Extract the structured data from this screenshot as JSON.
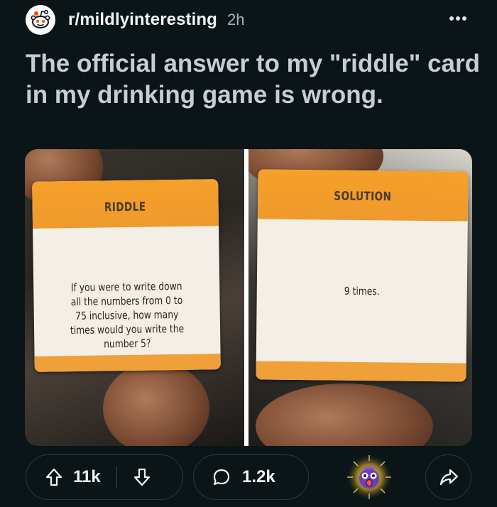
{
  "post": {
    "subreddit": "r/mildlyinteresting",
    "age": "2h",
    "title": "The official answer to my \"riddle\" card in my drinking game is wrong."
  },
  "media": {
    "left_card": {
      "heading": "RIDDLE",
      "lines": [
        "If you were to write down",
        "all the numbers from 0 to",
        "75 inclusive, how many",
        "times would you write the",
        "number 5?"
      ]
    },
    "right_card": {
      "heading": "SOLUTION",
      "lines": [
        "9 times."
      ]
    }
  },
  "actions": {
    "upvotes": "11k",
    "comments": "1.2k"
  },
  "icons": {
    "avatar": "reddit-snoo-icon",
    "more": "more-dots-icon",
    "upvote": "upvote-arrow-icon",
    "downvote": "downvote-arrow-icon",
    "comment": "comment-bubble-icon",
    "award": "award-shocked-face-icon",
    "share": "share-arrow-icon"
  },
  "colors": {
    "background": "#0b1416",
    "title_text": "#c8cdd1",
    "pill_border": "#2c3b40",
    "card_orange": "#f6a02a",
    "card_white": "#f4efe6"
  }
}
